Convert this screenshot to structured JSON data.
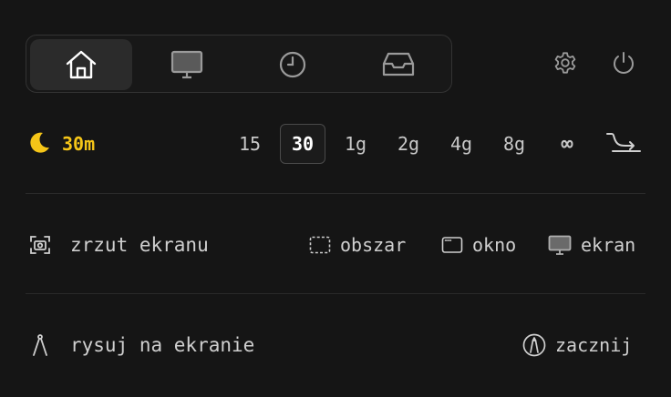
{
  "tabs": [
    {
      "name": "home",
      "icon": "home-icon",
      "active": true
    },
    {
      "name": "display",
      "icon": "monitor-icon",
      "active": false
    },
    {
      "name": "history",
      "icon": "clock-icon",
      "active": false
    },
    {
      "name": "inbox",
      "icon": "inbox-icon",
      "active": false
    }
  ],
  "top_actions": {
    "settings_icon": "gear-icon",
    "power_icon": "power-icon"
  },
  "timer": {
    "icon": "moon-icon",
    "current": "30m",
    "current_color": "#f5c518",
    "durations": [
      "15",
      "30",
      "1g",
      "2g",
      "4g",
      "8g",
      "∞"
    ],
    "selected": "30",
    "end_icon": "schedule-arrow-icon"
  },
  "screenshot": {
    "icon": "camera-icon",
    "label": "zrzut ekranu",
    "options": [
      {
        "icon": "dashed-rect-icon",
        "label": "obszar"
      },
      {
        "icon": "window-icon",
        "label": "okno"
      },
      {
        "icon": "monitor-icon",
        "label": "ekran"
      }
    ]
  },
  "draw": {
    "icon": "compass-icon",
    "label": "rysuj na ekranie",
    "action": {
      "icon": "pen-circle-icon",
      "label": "zacznij"
    }
  }
}
